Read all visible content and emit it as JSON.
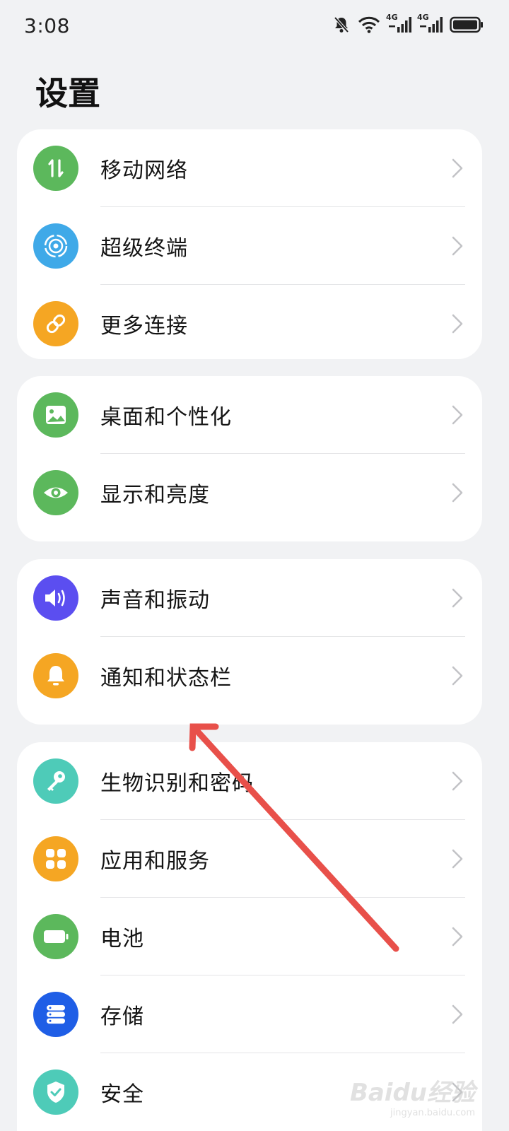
{
  "status_bar": {
    "time": "3:08",
    "icons": [
      "bell-off-icon",
      "wifi-icon",
      "signal-4g-icon",
      "signal-4g-icon",
      "battery-icon"
    ],
    "net_labels": [
      "4G",
      "4G"
    ]
  },
  "header": {
    "title": "设置"
  },
  "groups": [
    {
      "items": [
        {
          "label": "移动网络",
          "icon": "mobile-data-icon",
          "color": "#5cb85c"
        },
        {
          "label": "超级终端",
          "icon": "super-device-icon",
          "color": "#3fa9e8"
        },
        {
          "label": "更多连接",
          "icon": "link-icon",
          "color": "#f5a623"
        }
      ]
    },
    {
      "items": [
        {
          "label": "桌面和个性化",
          "icon": "wallpaper-icon",
          "color": "#5cb85c"
        },
        {
          "label": "显示和亮度",
          "icon": "eye-icon",
          "color": "#5cb85c"
        }
      ]
    },
    {
      "items": [
        {
          "label": "声音和振动",
          "icon": "speaker-icon",
          "color": "#5b4ef0"
        },
        {
          "label": "通知和状态栏",
          "icon": "bell-icon",
          "color": "#f5a623"
        }
      ]
    },
    {
      "items": [
        {
          "label": "生物识别和密码",
          "icon": "key-icon",
          "color": "#4ecbb8"
        },
        {
          "label": "应用和服务",
          "icon": "apps-icon",
          "color": "#f5a623"
        },
        {
          "label": "电池",
          "icon": "battery-icon",
          "color": "#5cb85c"
        },
        {
          "label": "存储",
          "icon": "storage-icon",
          "color": "#1f5ee6"
        },
        {
          "label": "安全",
          "icon": "shield-icon",
          "color": "#4ecbb8"
        }
      ]
    }
  ],
  "annotation": {
    "color": "#e8504a"
  },
  "watermark": {
    "main": "Baidu经验",
    "sub": "jingyan.baidu.com"
  }
}
